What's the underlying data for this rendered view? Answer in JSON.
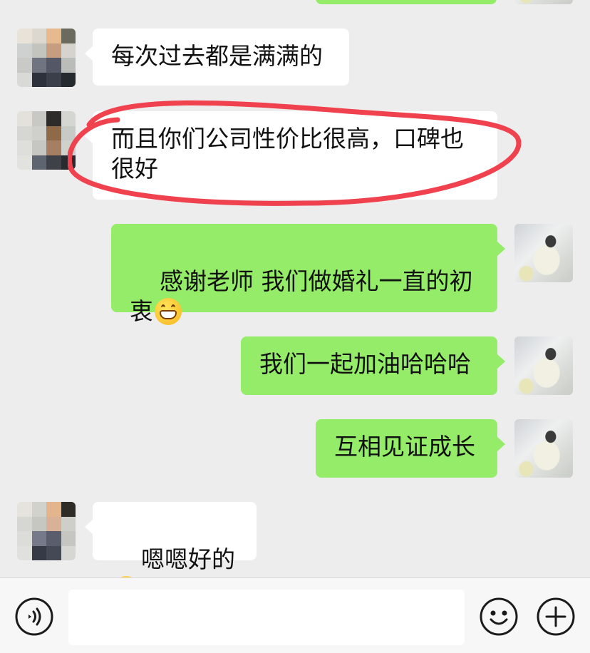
{
  "messages": [
    {
      "side": "in",
      "text": "每次过去都是满满的"
    },
    {
      "side": "in",
      "text": "而且你们公司性价比很高，口碑也很好"
    },
    {
      "side": "out",
      "text": "感谢老师 我们做婚礼一直的初衷",
      "emoji": "grinning-face"
    },
    {
      "side": "out",
      "text": "我们一起加油哈哈哈"
    },
    {
      "side": "out",
      "text": "互相见证成长"
    },
    {
      "side": "in",
      "text": "嗯嗯好的",
      "emoji": "grinning-face"
    }
  ],
  "composer": {
    "input_value": ""
  },
  "colors": {
    "incoming": "#ffffff",
    "outgoing": "#95ec69",
    "highlight": "#f0424e",
    "background": "#ededed"
  },
  "icons": {
    "voice": "voice-icon",
    "emoji": "emoji-icon",
    "more": "plus-icon"
  }
}
